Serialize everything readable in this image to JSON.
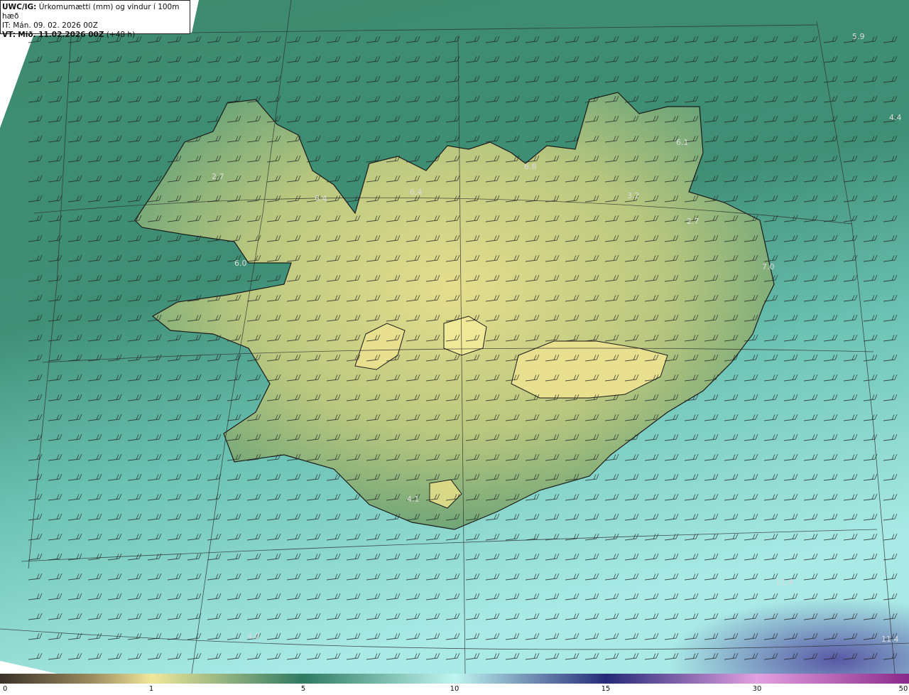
{
  "header": {
    "model": "UWC/IG:",
    "title": "Úrkomumætti (mm) og vindur í 100m hæð",
    "it_label": "IT:",
    "it_value": "Mán. 09. 02. 2026 00Z",
    "vt_label": "VT:",
    "vt_value": "Mið. 11.02.2026 00Z",
    "lead": "(+48 h)"
  },
  "colorbar": {
    "ticks": [
      "0",
      "1",
      "5",
      "10",
      "15",
      "30",
      "50"
    ],
    "colors": [
      "#3a3128",
      "#8a7a52",
      "#f0e79a",
      "#2f7a62",
      "#bff5f0",
      "#2a2f7a",
      "#d88ad8",
      "#8a2a8a"
    ]
  },
  "value_labels": [
    "5.9",
    "4.4",
    "6.1",
    "6.8",
    "2.7",
    "6.4",
    "6.4",
    "3.2",
    "2.7",
    "6.0",
    "7.0",
    "4.1",
    "12.4",
    "11.4",
    "4.0"
  ],
  "colors": {
    "ocean_north": "#3e8a6e",
    "ocean_south": "#b6f0ea",
    "land_high": "#e9e291",
    "land_mid": "#6fae7c",
    "deep_purple": "#5a4aa0"
  }
}
